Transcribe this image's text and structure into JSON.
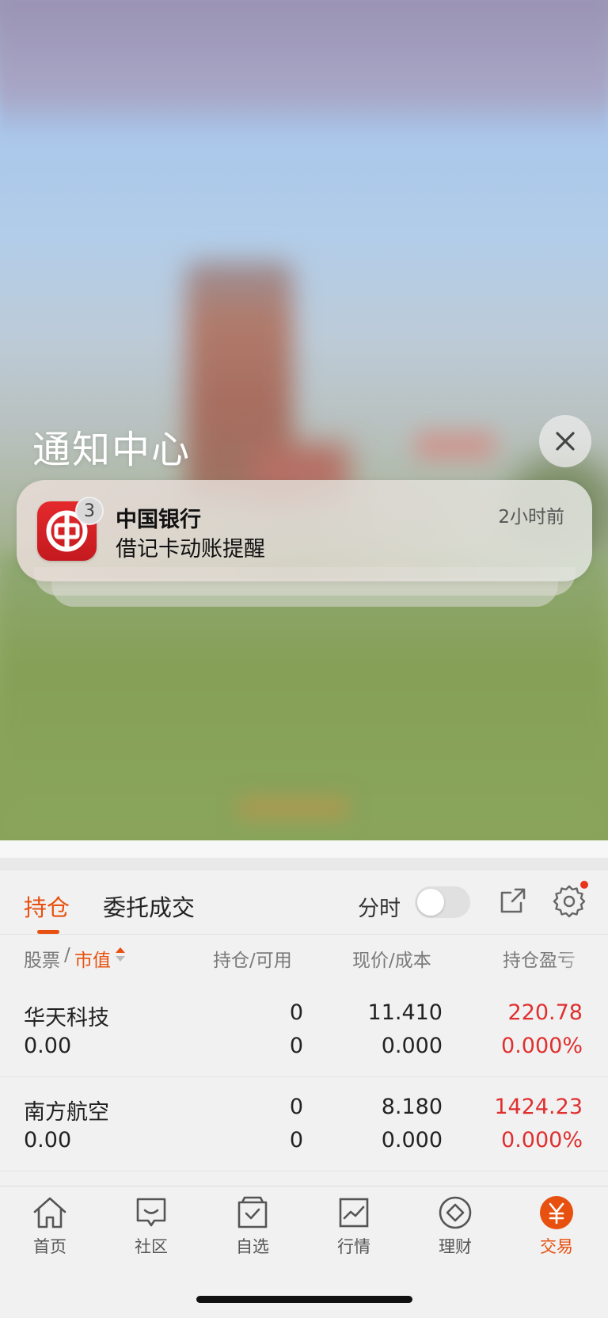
{
  "notification_center": {
    "title": "通知中心",
    "notification": {
      "app_name": "中国银行",
      "time": "2小时前",
      "message": "借记卡动账提醒",
      "badge_count": "3"
    }
  },
  "trade": {
    "tabs": [
      {
        "label": "持仓",
        "active": true
      },
      {
        "label": "委托成交",
        "active": false
      }
    ],
    "fenshi_label": "分时",
    "fenshi_on": false,
    "table_headers": {
      "stock": "股票",
      "market_value": "市值",
      "position": "持仓/可用",
      "price": "现价/成本",
      "pnl": "持仓盈亏"
    },
    "rows": [
      {
        "name": "华天科技",
        "value": "0.00",
        "position": "0",
        "available": "0",
        "price": "11.410",
        "cost": "0.000",
        "pnl": "220.78",
        "pnl_pct": "0.000%"
      },
      {
        "name": "南方航空",
        "value": "0.00",
        "position": "0",
        "available": "0",
        "price": "8.180",
        "cost": "0.000",
        "pnl": "1424.23",
        "pnl_pct": "0.000%"
      }
    ]
  },
  "tabbar": {
    "items": [
      {
        "label": "首页",
        "icon": "home-icon"
      },
      {
        "label": "社区",
        "icon": "community-icon"
      },
      {
        "label": "自选",
        "icon": "watchlist-icon"
      },
      {
        "label": "行情",
        "icon": "market-icon"
      },
      {
        "label": "理财",
        "icon": "wealth-icon"
      },
      {
        "label": "交易",
        "icon": "trade-icon",
        "active": true
      }
    ]
  },
  "colors": {
    "accent": "#e8500f",
    "gain_red": "#e02f2f",
    "boc_red": "#d7262b"
  }
}
